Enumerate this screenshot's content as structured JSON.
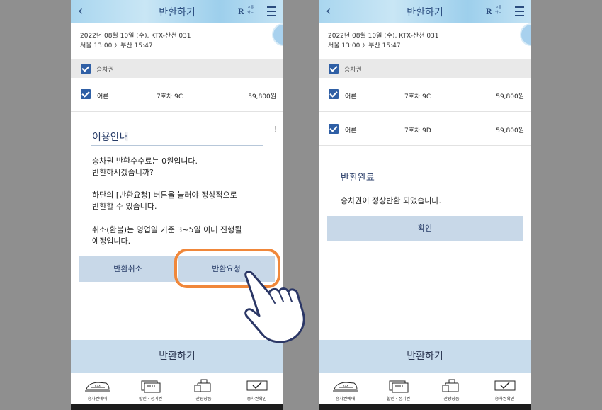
{
  "header": {
    "back_icon": "‹",
    "title": "반환하기",
    "logo_mark": "R",
    "logo_text_line1": "교통",
    "logo_text_line2": "카드"
  },
  "trip": {
    "line1": "2022년 08월 10일 (수), KTX-산천 031",
    "line2": "서울 13:00 〉부산 15:47"
  },
  "section": {
    "label": "승차권"
  },
  "left_screen": {
    "tickets": [
      {
        "passenger": "어른",
        "seat": "7호차 9C",
        "price": "59,800원"
      }
    ],
    "exclaim": "!",
    "dialog": {
      "title": "이용안내",
      "msg1_l1": "승차권 반환수수료는 0원입니다.",
      "msg1_l2": "반환하시겠습니까?",
      "msg2_l1": "하단의 [반환요청] 버튼을 눌러야 정상적으로",
      "msg2_l2": "반환할 수 있습니다.",
      "msg3_l1": "취소(환불)는 영업일 기준 3~5일 이내 진행될",
      "msg3_l2": "예정입니다.",
      "cancel_label": "반환취소",
      "request_label": "반환요청"
    }
  },
  "right_screen": {
    "tickets": [
      {
        "passenger": "어른",
        "seat": "7호차 9C",
        "price": "59,800원"
      },
      {
        "passenger": "어른",
        "seat": "7호차 9D",
        "price": "59,800원"
      }
    ],
    "dialog": {
      "title": "반환완료",
      "message": "승차권이 정상반환 되었습니다.",
      "confirm_label": "확인"
    }
  },
  "bottom_action": {
    "label": "반환하기"
  },
  "nav": [
    {
      "label": "승차권예매",
      "icon": "train-icon"
    },
    {
      "label": "할인 · 정기권",
      "icon": "ticket-stack-icon"
    },
    {
      "label": "관광상품",
      "icon": "luggage-icon"
    },
    {
      "label": "승차권확인",
      "icon": "ticket-check-icon"
    }
  ],
  "colors": {
    "accent": "#2f5fa5",
    "highlight": "#f0873a",
    "button": "#c8d8e8",
    "header": "#a9d6ef"
  }
}
